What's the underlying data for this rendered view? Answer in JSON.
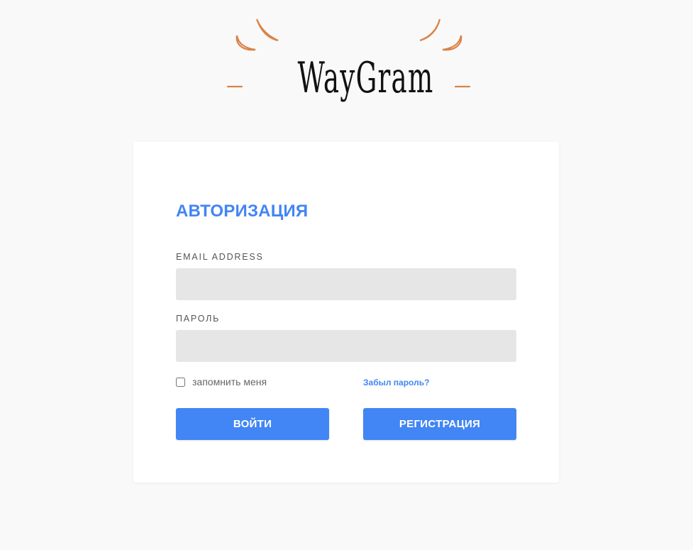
{
  "logo": {
    "text": "WayGram",
    "accent_color": "#d9844a"
  },
  "login_card": {
    "title": "АВТОРИЗАЦИЯ",
    "email": {
      "label": "EMAIL ADDRESS",
      "value": "",
      "placeholder": ""
    },
    "password": {
      "label": "ПАРОЛЬ",
      "value": "",
      "placeholder": ""
    },
    "remember_me": {
      "label": "запомнить меня",
      "checked": false
    },
    "forgot_password": "Забыл пароль?",
    "login_button": "ВОЙТИ",
    "register_button": "РЕГИСТРАЦИЯ"
  },
  "colors": {
    "page_background": "#f9f9f9",
    "primary": "#4285f4",
    "input_background": "#e6e6e6",
    "card_background": "#ffffff"
  }
}
